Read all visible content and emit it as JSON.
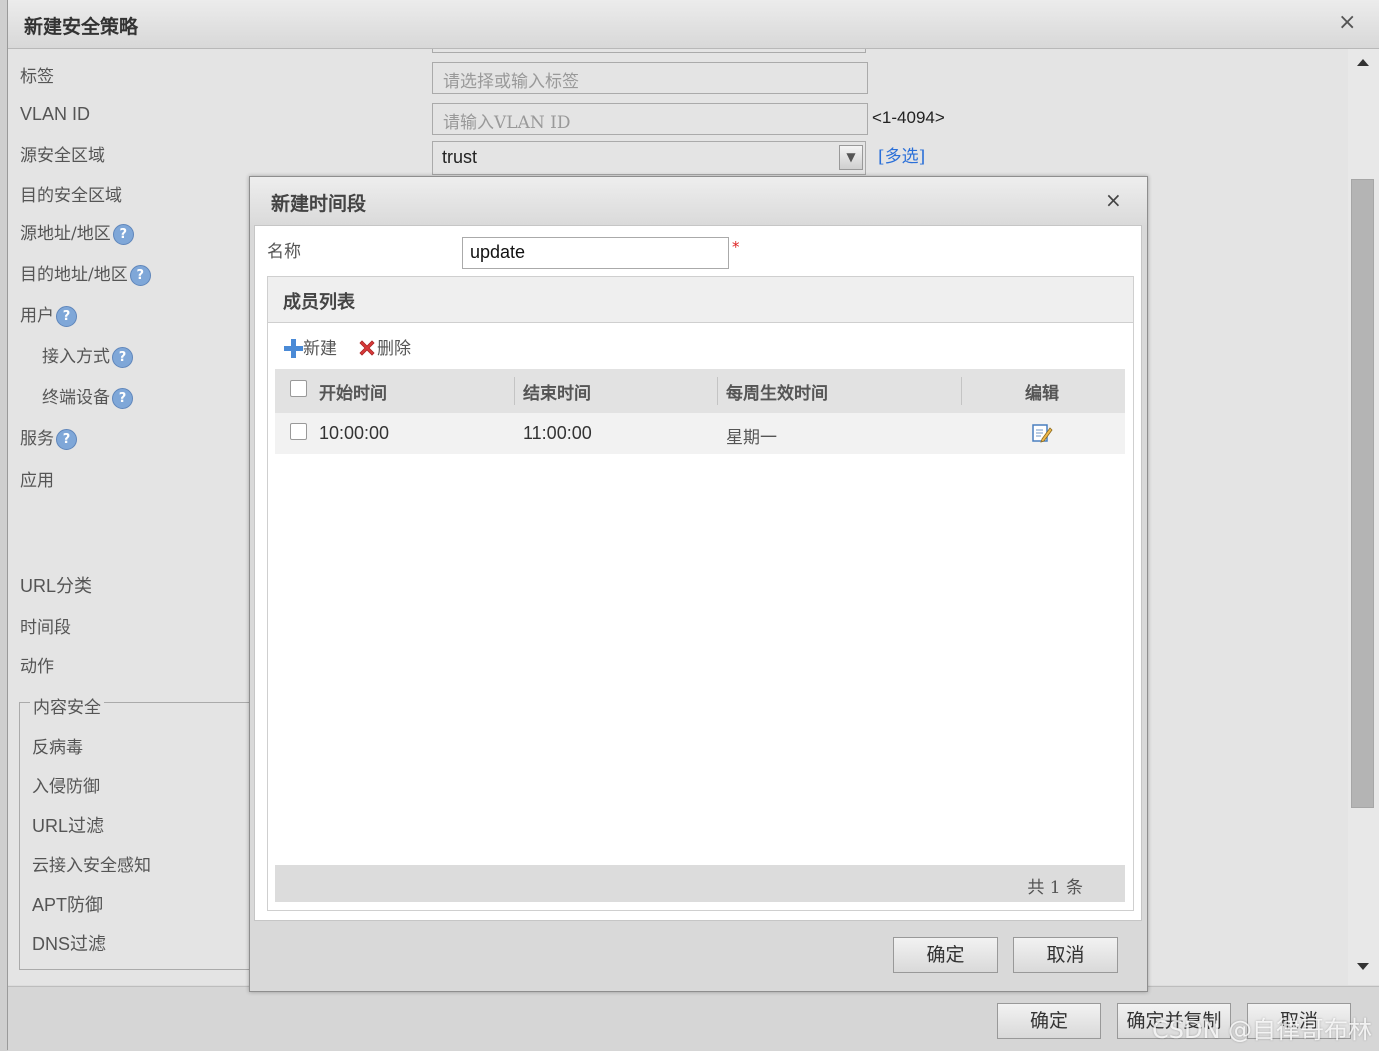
{
  "outer_dialog": {
    "title": "新建安全策略",
    "form": {
      "tag_label": "标签",
      "tag_placeholder": "请选择或输入标签",
      "vlan_label": "VLAN ID",
      "vlan_placeholder": "请输入VLAN ID",
      "vlan_range": "<1-4094>",
      "src_zone_label": "源安全区域",
      "src_zone_value": "trust",
      "multi_select": "[多选]",
      "dst_zone_label": "目的安全区域",
      "src_addr_label": "源地址/地区",
      "dst_addr_label": "目的地址/地区",
      "user_label": "用户",
      "access_mode_label": "接入方式",
      "terminal_label": "终端设备",
      "service_label": "服务",
      "app_label": "应用",
      "url_category_label": "URL分类",
      "time_range_label": "时间段",
      "action_label": "动作",
      "content_security": {
        "legend": "内容安全",
        "items": [
          "反病毒",
          "入侵防御",
          "URL过滤",
          "云接入安全感知",
          "APT防御",
          "DNS过滤"
        ]
      }
    },
    "footer": {
      "ok": "确定",
      "ok_copy": "确定并复制",
      "cancel": "取消"
    }
  },
  "inner_dialog": {
    "title": "新建时间段",
    "name_label": "名称",
    "name_value": "update",
    "required_mark": "*",
    "member_panel": {
      "title": "成员列表",
      "toolbar": {
        "add": "新建",
        "delete": "删除"
      },
      "columns": [
        "开始时间",
        "结束时间",
        "每周生效时间",
        "编辑"
      ],
      "rows": [
        {
          "start": "10:00:00",
          "end": "11:00:00",
          "weekly": "星期一"
        }
      ],
      "footer_total": "共 1 条"
    },
    "footer": {
      "ok": "确定",
      "cancel": "取消"
    }
  },
  "watermark": "CSDN @自律哥布林",
  "help_glyph": "?",
  "close_glyph": "×",
  "icons": {
    "add": "plus-icon",
    "delete": "delete-x-icon",
    "edit": "edit-icon",
    "help": "help-circle-icon"
  },
  "colors": {
    "help_icon": "#7fa7d8",
    "link": "#2a6fd8",
    "required": "#dd2222",
    "add_icon": "#4a8ad6",
    "delete_icon": "#d83a3a"
  }
}
